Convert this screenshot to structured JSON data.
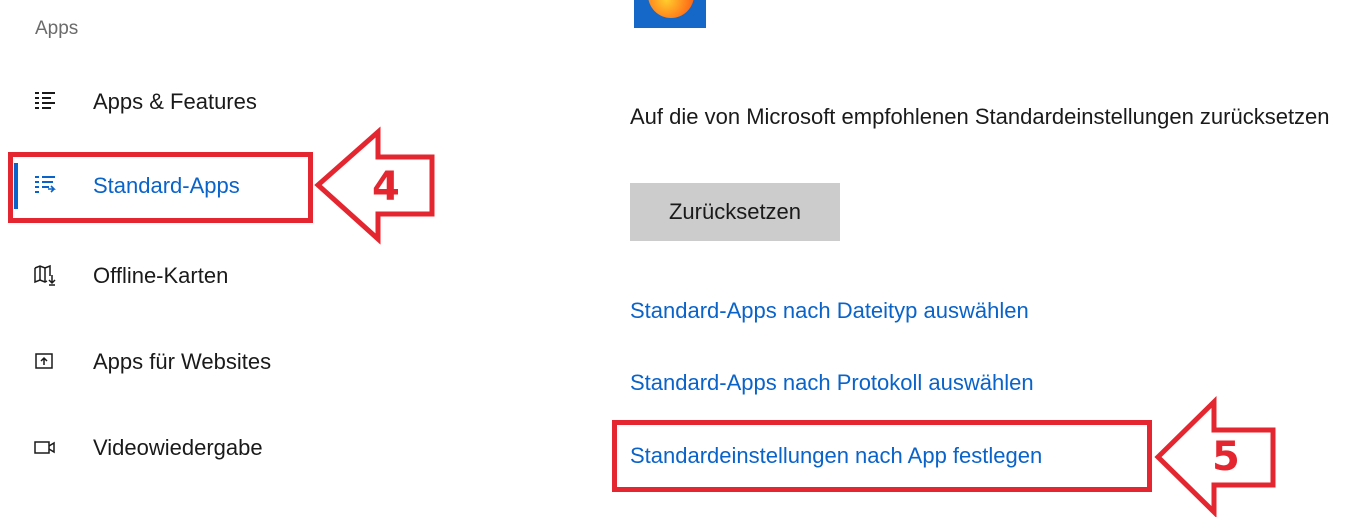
{
  "sidebar": {
    "section_title": "Apps",
    "items": [
      {
        "label": "Apps & Features",
        "icon": "list-icon"
      },
      {
        "label": "Standard-Apps",
        "icon": "default-apps-icon",
        "active": true
      },
      {
        "label": "Offline-Karten",
        "icon": "map-download-icon"
      },
      {
        "label": "Apps für Websites",
        "icon": "open-in-app-icon"
      },
      {
        "label": "Videowiedergabe",
        "icon": "video-camera-icon"
      }
    ]
  },
  "main": {
    "reset_description": "Auf die von Microsoft empfohlenen Standardeinstellungen zurücksetzen",
    "reset_button": "Zurücksetzen",
    "links": [
      "Standard-Apps nach Dateityp auswählen",
      "Standard-Apps nach Protokoll auswählen",
      "Standardeinstellungen nach App festlegen"
    ]
  },
  "annotations": {
    "step4": "4",
    "step5": "5",
    "color": "#e3262f"
  },
  "colors": {
    "accent": "#0a63c9",
    "button_bg": "#cccccc",
    "muted_text": "#6b6b6b"
  }
}
